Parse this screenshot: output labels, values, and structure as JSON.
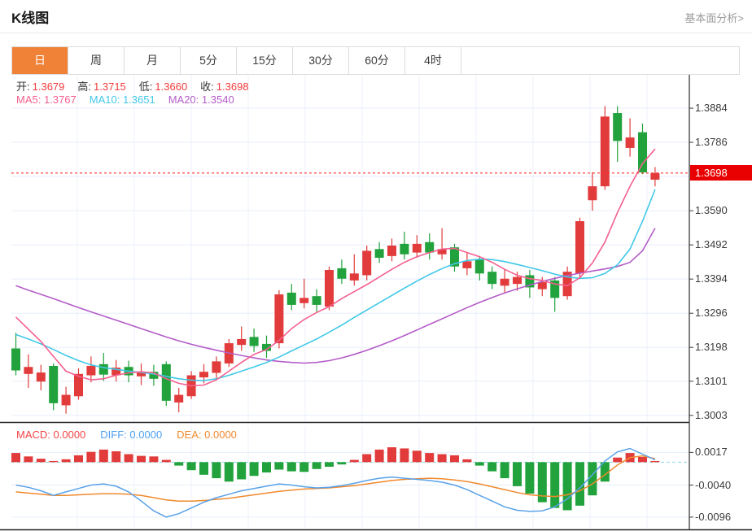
{
  "header": {
    "title": "K线图",
    "link": "基本面分析>"
  },
  "tabs": {
    "selected": "日",
    "items": [
      {
        "label": "日"
      },
      {
        "label": "周"
      },
      {
        "label": "月"
      },
      {
        "label": "5分"
      },
      {
        "label": "15分"
      },
      {
        "label": "30分"
      },
      {
        "label": "60分"
      },
      {
        "label": "4时"
      }
    ]
  },
  "ohlc": {
    "open_label": "开:",
    "open": "1.3679",
    "high_label": "高:",
    "high": "1.3715",
    "low_label": "低:",
    "low": "1.3660",
    "close_label": "收:",
    "close": "1.3698"
  },
  "ma": {
    "ma5_label": "MA5:",
    "ma5": "1.3767",
    "ma10_label": "MA10:",
    "ma10": "1.3651",
    "ma20_label": "MA20:",
    "ma20": "1.3540"
  },
  "macd_header": {
    "macd_label": "MACD:",
    "macd": "0.0000",
    "diff_label": "DIFF:",
    "diff": "0.0000",
    "dea_label": "DEA:",
    "dea": "0.0000"
  },
  "price_axis": {
    "labels": [
      {
        "text": "1.3884",
        "value": 1.3884
      },
      {
        "text": "1.3786",
        "value": 1.3786
      },
      {
        "text": "1.3590",
        "value": 1.359
      },
      {
        "text": "1.3492",
        "value": 1.3492
      },
      {
        "text": "1.3394",
        "value": 1.3394
      },
      {
        "text": "1.3296",
        "value": 1.3296
      },
      {
        "text": "1.3198",
        "value": 1.3198
      },
      {
        "text": "1.3101",
        "value": 1.3101
      },
      {
        "text": "1.3003",
        "value": 1.3003
      }
    ],
    "grid_values": [
      1.3884,
      1.3786,
      1.3688,
      1.359,
      1.3492,
      1.3394,
      1.3296,
      1.3198,
      1.3101,
      1.3003
    ],
    "current": "1.3698",
    "current_value": 1.3698
  },
  "macd_axis": {
    "labels": [
      {
        "text": "0.0017",
        "value": 0.0017
      },
      {
        "text": "-0.0040",
        "value": -0.004
      },
      {
        "text": "-0.0096",
        "value": -0.0096
      }
    ]
  },
  "colors": {
    "up": "#e23b3b",
    "down": "#22a23c",
    "ma5": "#f4608f",
    "ma10": "#41c8e8",
    "ma20": "#b45cc8",
    "diff": "#5aa2e8",
    "dea": "#f08a2e",
    "tab_active": "#ef8236",
    "price_line": "#ff2d2d",
    "badge_bg": "#e90000",
    "grid": "#e7eefa",
    "grid_vertical": "#edf2fb",
    "zero_line": "#8ed7ec",
    "axis": "#3a3a3a"
  },
  "chart_data": [
    {
      "type": "candlestick",
      "title": "K线图",
      "period_selected": "日",
      "ylim": [
        1.2984,
        1.3989
      ],
      "current_price": 1.3698,
      "candles": [
        [
          1.3195,
          1.324,
          1.3118,
          1.3132
        ],
        [
          1.3122,
          1.3178,
          1.3082,
          1.3142
        ],
        [
          1.31,
          1.3148,
          1.3075,
          1.3126
        ],
        [
          1.3145,
          1.3152,
          1.3018,
          1.3038
        ],
        [
          1.3032,
          1.3085,
          1.3008,
          1.3062
        ],
        [
          1.3058,
          1.3138,
          1.3048,
          1.3122
        ],
        [
          1.3118,
          1.3172,
          1.3098,
          1.3145
        ],
        [
          1.315,
          1.3182,
          1.3102,
          1.312
        ],
        [
          1.3118,
          1.3162,
          1.31,
          1.314
        ],
        [
          1.3142,
          1.316,
          1.3098,
          1.3118
        ],
        [
          1.3115,
          1.3152,
          1.309,
          1.3128
        ],
        [
          1.3128,
          1.3148,
          1.3088,
          1.3108
        ],
        [
          1.315,
          1.3158,
          1.303,
          1.3045
        ],
        [
          1.304,
          1.3082,
          1.3012,
          1.3062
        ],
        [
          1.3058,
          1.313,
          1.305,
          1.3118
        ],
        [
          1.3112,
          1.315,
          1.3095,
          1.3128
        ],
        [
          1.3125,
          1.3172,
          1.3108,
          1.3158
        ],
        [
          1.3152,
          1.3222,
          1.3142,
          1.321
        ],
        [
          1.3205,
          1.3258,
          1.3188,
          1.3222
        ],
        [
          1.3228,
          1.3252,
          1.3185,
          1.3202
        ],
        [
          1.3208,
          1.3232,
          1.3168,
          1.3188
        ],
        [
          1.321,
          1.3362,
          1.3195,
          1.335
        ],
        [
          1.3355,
          1.338,
          1.3305,
          1.332
        ],
        [
          1.3325,
          1.3395,
          1.331,
          1.334
        ],
        [
          1.3345,
          1.3365,
          1.33,
          1.332
        ],
        [
          1.3315,
          1.343,
          1.3305,
          1.342
        ],
        [
          1.3425,
          1.345,
          1.338,
          1.3395
        ],
        [
          1.339,
          1.3465,
          1.3375,
          1.341
        ],
        [
          1.3405,
          1.349,
          1.339,
          1.3475
        ],
        [
          1.348,
          1.35,
          1.344,
          1.3455
        ],
        [
          1.346,
          1.351,
          1.3445,
          1.349
        ],
        [
          1.3495,
          1.353,
          1.345,
          1.3465
        ],
        [
          1.347,
          1.352,
          1.3455,
          1.3495
        ],
        [
          1.35,
          1.3525,
          1.345,
          1.347
        ],
        [
          1.3465,
          1.354,
          1.345,
          1.348
        ],
        [
          1.3485,
          1.3495,
          1.3415,
          1.343
        ],
        [
          1.3425,
          1.347,
          1.3405,
          1.3445
        ],
        [
          1.345,
          1.346,
          1.339,
          1.341
        ],
        [
          1.3415,
          1.343,
          1.3365,
          1.338
        ],
        [
          1.3375,
          1.342,
          1.3355,
          1.3395
        ],
        [
          1.338,
          1.3415,
          1.336,
          1.34
        ],
        [
          1.3405,
          1.342,
          1.334,
          1.337
        ],
        [
          1.3365,
          1.34,
          1.3345,
          1.3385
        ],
        [
          1.339,
          1.34,
          1.33,
          1.334
        ],
        [
          1.3345,
          1.343,
          1.3335,
          1.3415
        ],
        [
          1.341,
          1.357,
          1.34,
          1.356
        ],
        [
          1.362,
          1.37,
          1.359,
          1.366
        ],
        [
          1.366,
          1.389,
          1.365,
          1.386
        ],
        [
          1.387,
          1.389,
          1.373,
          1.379
        ],
        [
          1.377,
          1.3855,
          1.3745,
          1.38
        ],
        [
          1.3815,
          1.384,
          1.3695,
          1.37
        ],
        [
          1.3679,
          1.3715,
          1.366,
          1.3698
        ]
      ],
      "overlays": [
        {
          "name": "MA5",
          "color": "#f4608f",
          "values": [
            1.3285,
            1.325,
            1.3215,
            1.3172,
            1.313,
            1.3115,
            1.3105,
            1.3108,
            1.3118,
            1.3125,
            1.3128,
            1.3125,
            1.3108,
            1.3095,
            1.3088,
            1.309,
            1.3105,
            1.313,
            1.3155,
            1.3178,
            1.3192,
            1.3218,
            1.3252,
            1.3278,
            1.3298,
            1.3315,
            1.3338,
            1.3358,
            1.3378,
            1.34,
            1.3422,
            1.3442,
            1.3458,
            1.347,
            1.348,
            1.3482,
            1.347,
            1.3458,
            1.3442,
            1.3422,
            1.3405,
            1.3395,
            1.339,
            1.338,
            1.3375,
            1.3398,
            1.344,
            1.35,
            1.3585,
            1.366,
            1.3725,
            1.3767
          ]
        },
        {
          "name": "MA10",
          "color": "#41c8e8",
          "values": [
            1.3235,
            1.3222,
            1.3208,
            1.3192,
            1.3175,
            1.316,
            1.3148,
            1.314,
            1.3135,
            1.313,
            1.3126,
            1.3122,
            1.3115,
            1.3108,
            1.3104,
            1.3103,
            1.3108,
            1.3118,
            1.313,
            1.3142,
            1.3155,
            1.317,
            1.3188,
            1.3205,
            1.3222,
            1.3242,
            1.3262,
            1.3284,
            1.3305,
            1.3326,
            1.3347,
            1.3368,
            1.3388,
            1.3407,
            1.3424,
            1.3438,
            1.3447,
            1.3451,
            1.345,
            1.3444,
            1.3436,
            1.3427,
            1.3418,
            1.3408,
            1.34,
            1.3396,
            1.3398,
            1.341,
            1.3435,
            1.348,
            1.356,
            1.3651
          ]
        },
        {
          "name": "MA20",
          "color": "#b45cc8",
          "values": [
            1.3375,
            1.3362,
            1.335,
            1.3338,
            1.3325,
            1.3312,
            1.33,
            1.3288,
            1.3276,
            1.3264,
            1.3252,
            1.324,
            1.3228,
            1.3217,
            1.3207,
            1.3198,
            1.319,
            1.3182,
            1.3175,
            1.3168,
            1.3162,
            1.3158,
            1.3155,
            1.3153,
            1.3155,
            1.316,
            1.3168,
            1.3178,
            1.319,
            1.3203,
            1.3217,
            1.3232,
            1.3248,
            1.3264,
            1.328,
            1.3296,
            1.3312,
            1.3327,
            1.3341,
            1.3354,
            1.3366,
            1.3377,
            1.3387,
            1.3396,
            1.3404,
            1.3411,
            1.3417,
            1.3423,
            1.343,
            1.3442,
            1.3475,
            1.354
          ]
        }
      ]
    },
    {
      "type": "macd",
      "ylim": [
        -0.0116,
        0.0063
      ],
      "y_ticks": [
        0.0017,
        -0.004,
        -0.0096
      ],
      "histogram": [
        0.0016,
        0.001,
        0.0006,
        0.0002,
        0.0005,
        0.0012,
        0.0018,
        0.0022,
        0.0019,
        0.0014,
        0.0011,
        0.001,
        0.0004,
        -0.0006,
        -0.0014,
        -0.0022,
        -0.0028,
        -0.0034,
        -0.003,
        -0.0024,
        -0.0018,
        -0.0013,
        -0.0016,
        -0.0017,
        -0.0012,
        -0.0008,
        -0.0004,
        0.0004,
        0.0014,
        0.0022,
        0.0026,
        0.0024,
        0.002,
        0.0016,
        0.0014,
        0.0012,
        0.0005,
        -0.0006,
        -0.0016,
        -0.0028,
        -0.0042,
        -0.0055,
        -0.007,
        -0.008,
        -0.0084,
        -0.0076,
        -0.0058,
        -0.0034,
        0.0008,
        0.0016,
        0.0009,
        0.0002
      ],
      "diff": [
        -0.004,
        -0.0044,
        -0.005,
        -0.0058,
        -0.0052,
        -0.0046,
        -0.004,
        -0.0038,
        -0.0042,
        -0.0052,
        -0.0068,
        -0.0085,
        -0.0096,
        -0.009,
        -0.008,
        -0.007,
        -0.0062,
        -0.0056,
        -0.005,
        -0.0046,
        -0.0042,
        -0.0038,
        -0.004,
        -0.0043,
        -0.0045,
        -0.0044,
        -0.0041,
        -0.0037,
        -0.0032,
        -0.0028,
        -0.0026,
        -0.0028,
        -0.003,
        -0.0032,
        -0.0035,
        -0.004,
        -0.0048,
        -0.0058,
        -0.0068,
        -0.0078,
        -0.0084,
        -0.0086,
        -0.0085,
        -0.0078,
        -0.0064,
        -0.0045,
        -0.0022,
        0.0002,
        0.0018,
        0.0024,
        0.0014,
        0.0004
      ],
      "dea": [
        -0.0052,
        -0.0054,
        -0.0056,
        -0.0058,
        -0.0058,
        -0.0057,
        -0.0056,
        -0.0055,
        -0.0055,
        -0.0056,
        -0.0058,
        -0.0062,
        -0.0066,
        -0.0068,
        -0.0068,
        -0.0067,
        -0.0065,
        -0.0063,
        -0.006,
        -0.0057,
        -0.0054,
        -0.0051,
        -0.0049,
        -0.0047,
        -0.0046,
        -0.0045,
        -0.0043,
        -0.0041,
        -0.0038,
        -0.0035,
        -0.0032,
        -0.003,
        -0.0029,
        -0.0028,
        -0.0029,
        -0.0031,
        -0.0034,
        -0.0038,
        -0.0043,
        -0.0048,
        -0.0053,
        -0.0057,
        -0.0059,
        -0.006,
        -0.0057,
        -0.005,
        -0.0038,
        -0.0022,
        -0.0005,
        0.0008,
        0.0011,
        0.0006
      ]
    }
  ]
}
